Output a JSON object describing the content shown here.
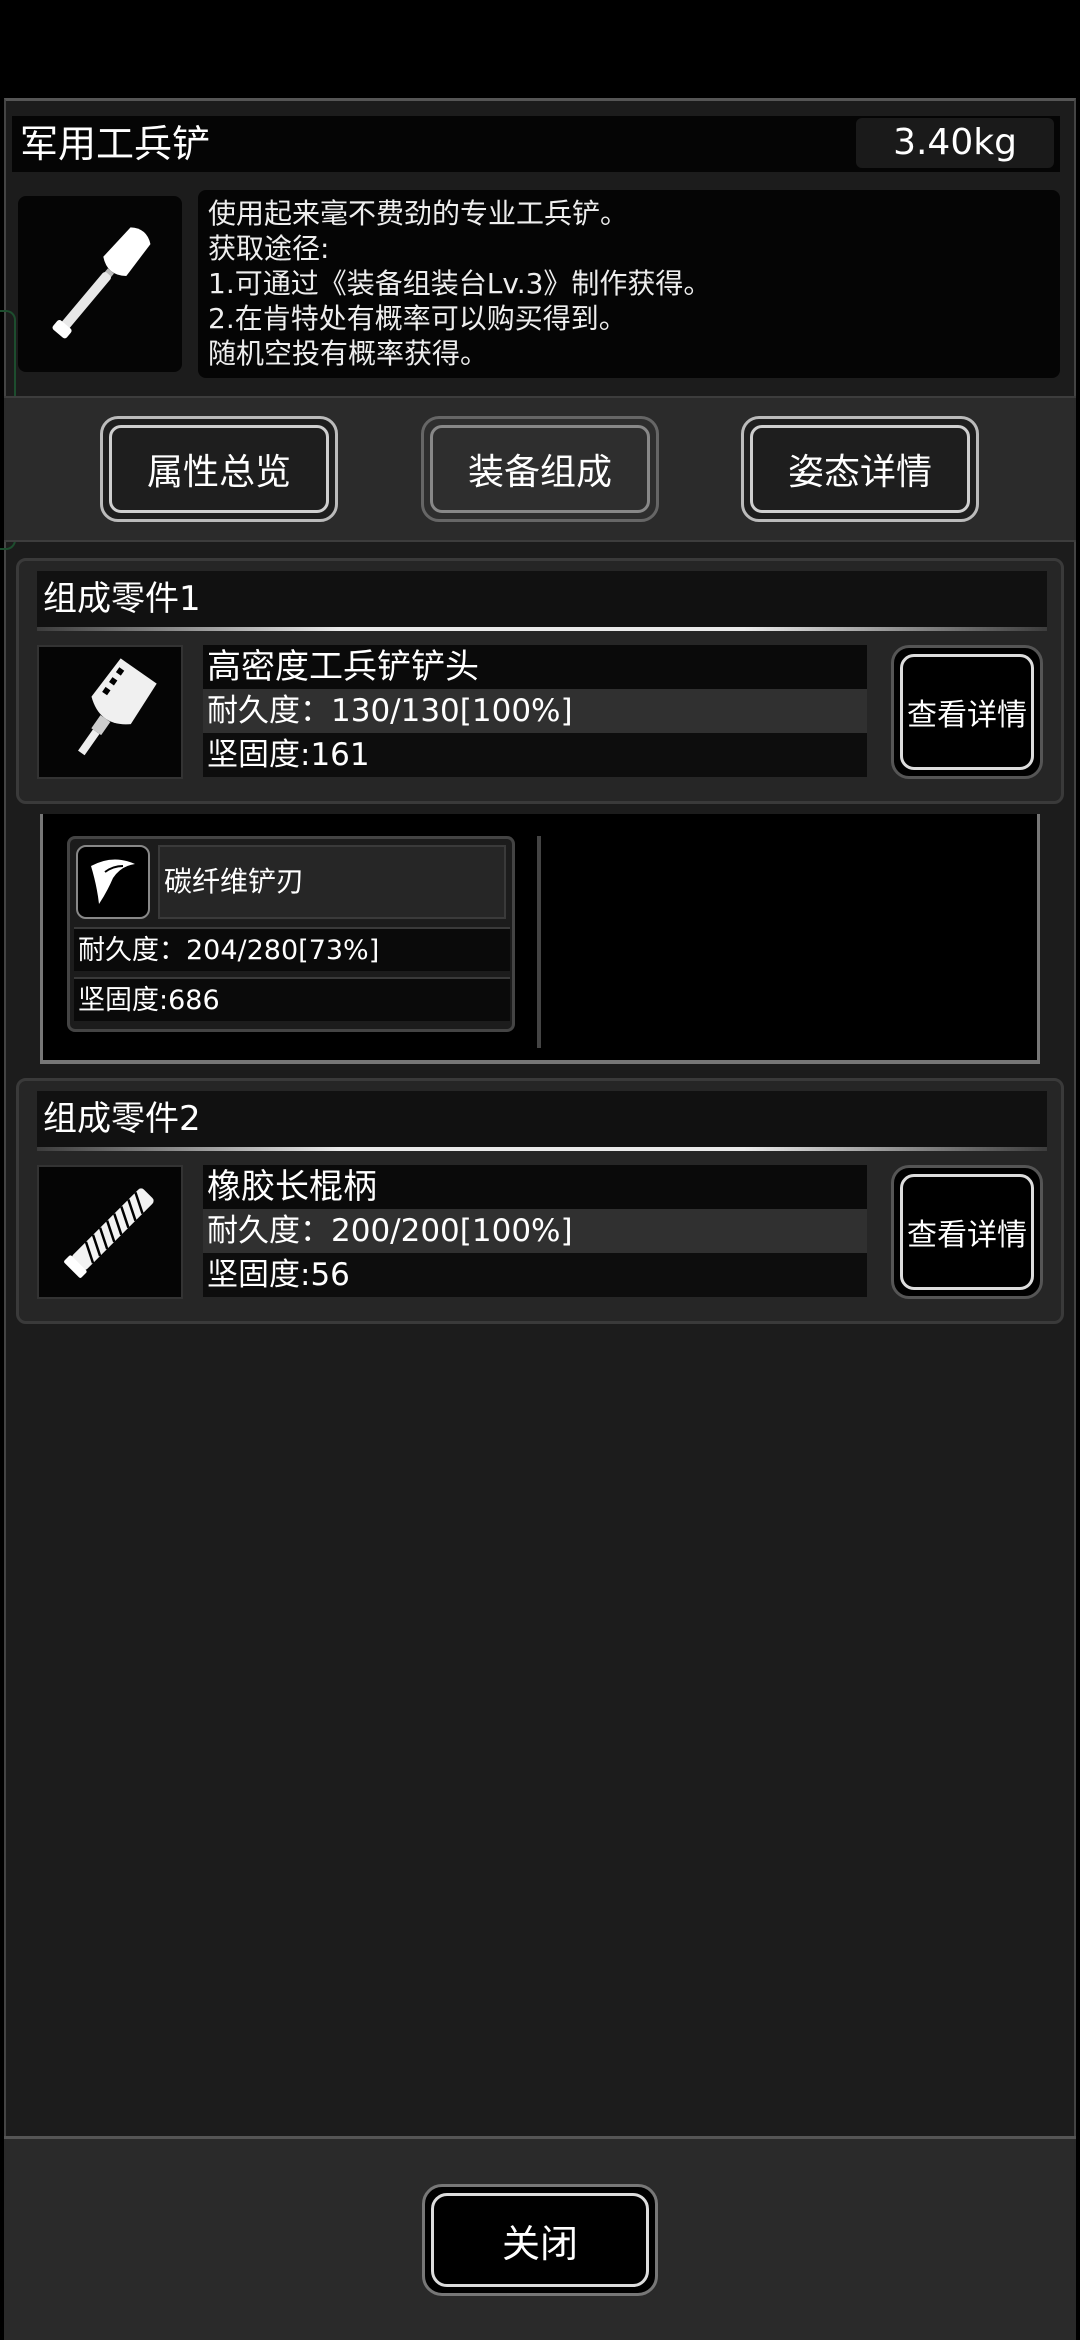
{
  "item": {
    "title": "军用工兵铲",
    "weight": "3.40kg",
    "icon": "shovel-icon",
    "description": [
      "使用起来毫不费劲的专业工兵铲。",
      "获取途径:",
      "1.可通过《装备组装台Lv.3》制作获得。",
      "2.在肯特处有概率可以购买得到。",
      "随机空投有概率获得。"
    ]
  },
  "tabs": [
    {
      "label": "属性总览",
      "active": false
    },
    {
      "label": "装备组成",
      "active": true
    },
    {
      "label": "姿态详情",
      "active": false
    }
  ],
  "parts": [
    {
      "header": "组成零件1",
      "icon": "shovel-head-icon",
      "name": "高密度工兵铲铲头",
      "durability": "耐久度：130/130[100%]",
      "hardness": "坚固度:161",
      "detail_label": "查看详情",
      "sub_part": {
        "icon": "blade-icon",
        "name": "碳纤维铲刃",
        "durability": "耐久度：204/280[73%]",
        "hardness": "坚固度:686"
      }
    },
    {
      "header": "组成零件2",
      "icon": "rubber-handle-icon",
      "name": "橡胶长棍柄",
      "durability": "耐久度：200/200[100%]",
      "hardness": "坚固度:56",
      "detail_label": "查看详情"
    }
  ],
  "close_label": "关闭"
}
